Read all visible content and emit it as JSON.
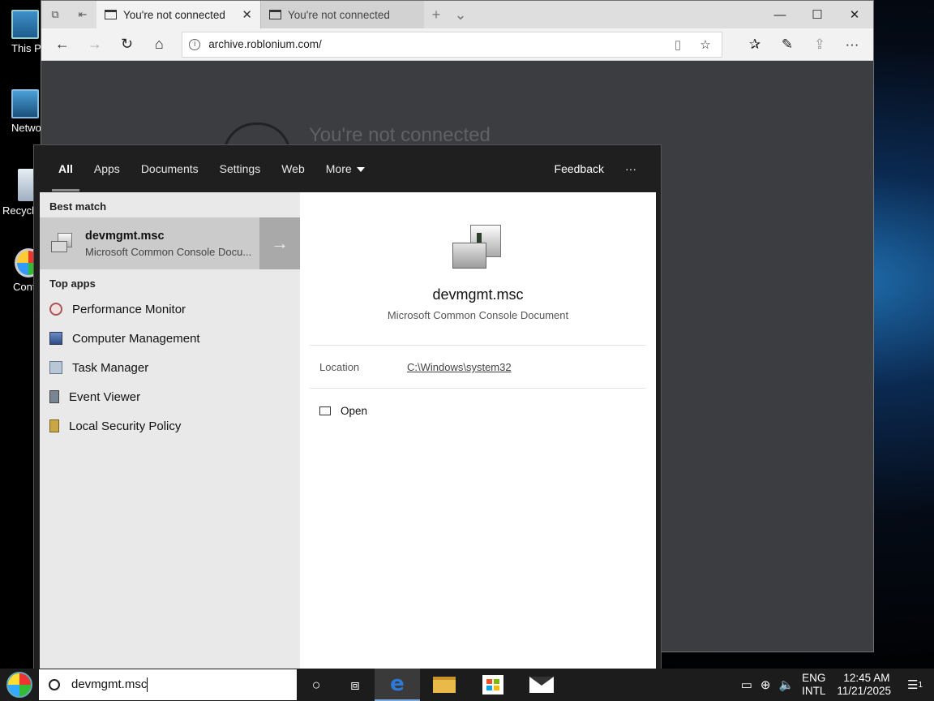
{
  "desktop": {
    "icons": [
      {
        "label": "This PC",
        "icon": "computer-icon"
      },
      {
        "label": "Network",
        "icon": "network-icon"
      },
      {
        "label": "Recycle Bin",
        "icon": "recycle-bin-icon"
      },
      {
        "label": "Control Panel",
        "icon": "control-panel-icon"
      }
    ]
  },
  "browser": {
    "tabs": [
      {
        "title": "You're not connected",
        "active": true
      },
      {
        "title": "You're not connected",
        "active": false
      }
    ],
    "address": "archive.roblonium.com/",
    "page_heading": "You're not connected",
    "window_controls": {
      "minimize": "—",
      "maximize": "☐",
      "close": "✕"
    }
  },
  "search": {
    "tabs": [
      "All",
      "Apps",
      "Documents",
      "Settings",
      "Web",
      "More"
    ],
    "feedback": "Feedback",
    "more_options": "···",
    "best_match_header": "Best match",
    "best_match": {
      "title": "devmgmt.msc",
      "subtitle": "Microsoft Common Console Docu..."
    },
    "top_apps_header": "Top apps",
    "top_apps": [
      {
        "label": "Performance Monitor",
        "icon": "performance-monitor-icon"
      },
      {
        "label": "Computer Management",
        "icon": "computer-management-icon"
      },
      {
        "label": "Task Manager",
        "icon": "task-manager-icon"
      },
      {
        "label": "Event Viewer",
        "icon": "event-viewer-icon"
      },
      {
        "label": "Local Security Policy",
        "icon": "local-security-policy-icon"
      }
    ],
    "detail": {
      "title": "devmgmt.msc",
      "subtitle": "Microsoft Common Console Document",
      "location_label": "Location",
      "location_value": "C:\\Windows\\system32",
      "open_label": "Open"
    }
  },
  "taskbar": {
    "search_text": "devmgmt.msc",
    "apps": [
      "cortana-icon",
      "task-view-icon",
      "edge-icon",
      "file-explorer-icon",
      "store-icon",
      "mail-icon"
    ],
    "language_top": "ENG",
    "language_bottom": "INTL",
    "time": "12:45 AM",
    "date": "11/21/2025",
    "notification_count": "1"
  }
}
